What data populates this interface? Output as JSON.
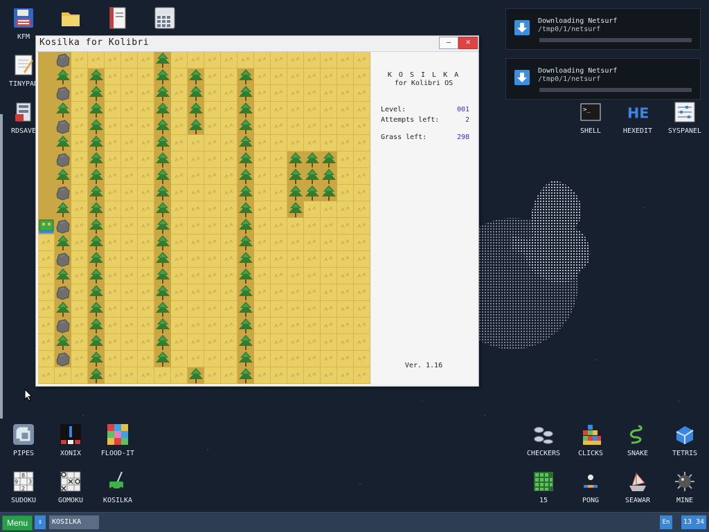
{
  "desktop_icons": [
    {
      "label": "KFM",
      "icon": "floppy-icon"
    },
    {
      "label": "",
      "icon": "folder-icon"
    },
    {
      "label": "",
      "icon": "book-icon"
    },
    {
      "label": "",
      "icon": "calculator-icon"
    },
    {
      "label": "TINYPAD",
      "icon": "notepad-icon"
    },
    {
      "label": "RDSAVE",
      "icon": "disk-save-icon"
    },
    {
      "label": "SHELL",
      "icon": "terminal-icon"
    },
    {
      "label": "HEXEDIT",
      "icon": "hexedit-icon"
    },
    {
      "label": "SYSPANEL",
      "icon": "syspanel-icon"
    },
    {
      "label": "PIPES",
      "icon": "pipes-icon"
    },
    {
      "label": "XONIX",
      "icon": "xonix-icon"
    },
    {
      "label": "FLOOD-IT",
      "icon": "flood-it-icon"
    },
    {
      "label": "SUDOKU",
      "icon": "sudoku-icon"
    },
    {
      "label": "GOMOKU",
      "icon": "gomoku-icon"
    },
    {
      "label": "KOSILKA",
      "icon": "lawnmower-icon"
    },
    {
      "label": "CHECKERS",
      "icon": "checkers-icon"
    },
    {
      "label": "CLICKS",
      "icon": "clicks-icon"
    },
    {
      "label": "SNAKE",
      "icon": "snake-icon"
    },
    {
      "label": "TETRIS",
      "icon": "tetris-icon"
    },
    {
      "label": "15",
      "icon": "fifteen-icon"
    },
    {
      "label": "PONG",
      "icon": "pong-icon"
    },
    {
      "label": "SEAWAR",
      "icon": "seawar-icon"
    },
    {
      "label": "MINE",
      "icon": "mine-icon"
    }
  ],
  "notifications": [
    {
      "title": "Downloading Netsurf",
      "path": "/tmp0/1/netsurf"
    },
    {
      "title": "Downloading Netsurf",
      "path": "/tmp0/1/netsurf"
    }
  ],
  "window": {
    "title": "Kosilka for Kolibri",
    "minimize_label": "—",
    "close_label": "✕"
  },
  "game": {
    "heading": "K O S I L K A",
    "subheading": "for Kolibri OS",
    "level_label": "Level:",
    "level_value": "001",
    "attempts_label": "Attempts left:",
    "attempts_value": "2",
    "grass_label": "Grass left:",
    "grass_value": "298",
    "version": "Ver. 1.16",
    "tile_legend": "G=grass, T=tree, R=rock, M=mowed, P=mower",
    "grid": [
      "MRGGGGGTGGGGGGGGGGGG",
      "MTGTGGGTGTGGTGGGGGGG",
      "MRGTGGGTGTGGTGGGGGGG",
      "MTGTGGGTGTGGTGGGGGGG",
      "MRGTGGGTGTGGTGGGGGGG",
      "MTGTGGGTGGGGTGGGGGGG",
      "MRGTGGGTGGGGTGGTTTGG",
      "MTGTGGGTGGGGTGGTTTGG",
      "MRGTGGGTGGGGTGGTTTGG",
      "MTGTGGGTGGGGTGGTGGGG",
      "PRGTGGGTGGGGTGGGGGGG",
      "GTGTGGGTGGGGTGGGGGGG",
      "GRGTGGGTGGGGTGGGGGGG",
      "GTGTGGGTGGGGTGGGGGGG",
      "GRGTGGGTGGGGTGGGGGGG",
      "GTGTGGGTGGGGTGGGGGGG",
      "GRGTGGGTGGGGTGGGGGGG",
      "GTGTGGGTGGGGTGGGGGGG",
      "GRGTGGGTGGGGTGGGGGGG",
      "GGGTGGGGGTGGTGGGGGGG"
    ]
  },
  "taskbar": {
    "menu_label": "Menu",
    "switch_label": "⇕",
    "task_label": "KOSILKA",
    "lang_label": "En",
    "clock": "13 34"
  },
  "colors": {
    "grass": "#e8cf66",
    "mowed": "#c9a745",
    "tree_leaf": "#2f7d2f",
    "rock": "#6e6e6e",
    "accent": "#3232c8"
  }
}
